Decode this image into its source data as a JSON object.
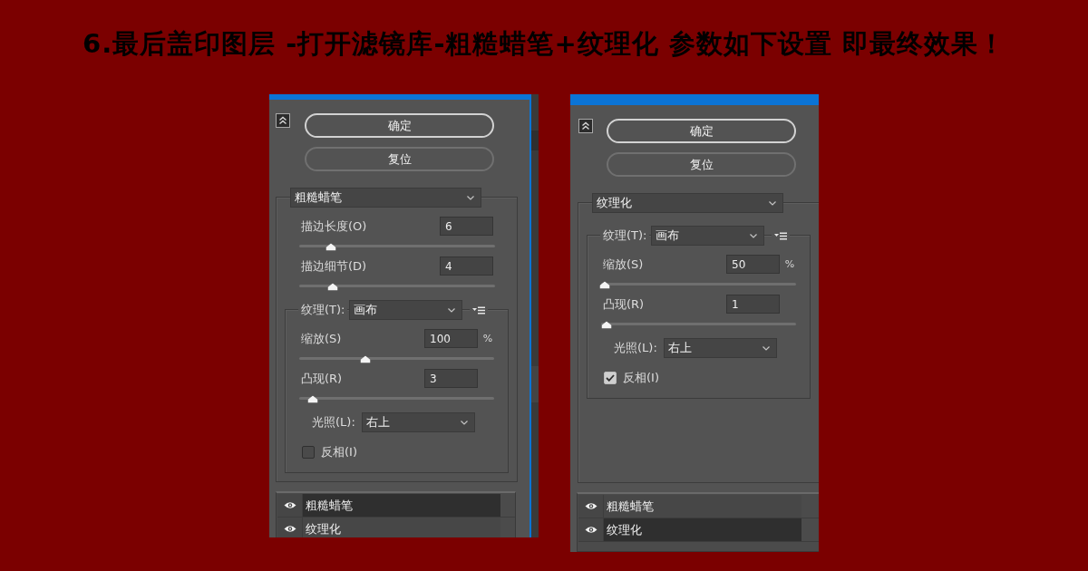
{
  "title": "6.最后盖印图层 -打开滤镜库-粗糙蜡笔+纹理化 参数如下设置 即最终效果！",
  "panels": [
    {
      "buttons": [
        {
          "label": "确定",
          "default": true
        },
        {
          "label": "复位",
          "default": false
        }
      ],
      "filter": "粗糙蜡笔",
      "controls": [
        {
          "kind": "slider",
          "label": "描边长度(O)",
          "value": "6",
          "level": 0.16
        },
        {
          "kind": "slider",
          "label": "描边细节(D)",
          "value": "4",
          "level": 0.17
        }
      ],
      "texture": {
        "label": "纹理(T):",
        "value": "画布",
        "controls": [
          {
            "kind": "slider",
            "label": "缩放(S)",
            "value": "100",
            "unit": "%",
            "level": 0.34
          },
          {
            "kind": "slider",
            "label": "凸现(R)",
            "value": "3",
            "level": 0.07
          },
          {
            "kind": "select",
            "label": "光照(L):",
            "value": "右上"
          },
          {
            "kind": "checkbox",
            "label": "反相(I)",
            "checked": false
          }
        ]
      },
      "layers": [
        {
          "name": "粗糙蜡笔",
          "selected": true
        },
        {
          "name": "纹理化",
          "selected": false
        }
      ]
    },
    {
      "buttons": [
        {
          "label": "确定",
          "default": true
        },
        {
          "label": "复位",
          "default": false
        }
      ],
      "filter": "纹理化",
      "texture": {
        "label": "纹理(T):",
        "value": "画布",
        "controls": [
          {
            "kind": "slider",
            "label": "缩放(S)",
            "value": "50",
            "unit": "%",
            "level": 0.02
          },
          {
            "kind": "slider",
            "label": "凸现(R)",
            "value": "1",
            "level": 0.03
          },
          {
            "kind": "select",
            "label": "光照(L):",
            "value": "右上"
          },
          {
            "kind": "checkbox",
            "label": "反相(I)",
            "checked": true
          }
        ]
      },
      "layers": [
        {
          "name": "粗糙蜡笔",
          "selected": false
        },
        {
          "name": "纹理化",
          "selected": true
        }
      ]
    }
  ]
}
